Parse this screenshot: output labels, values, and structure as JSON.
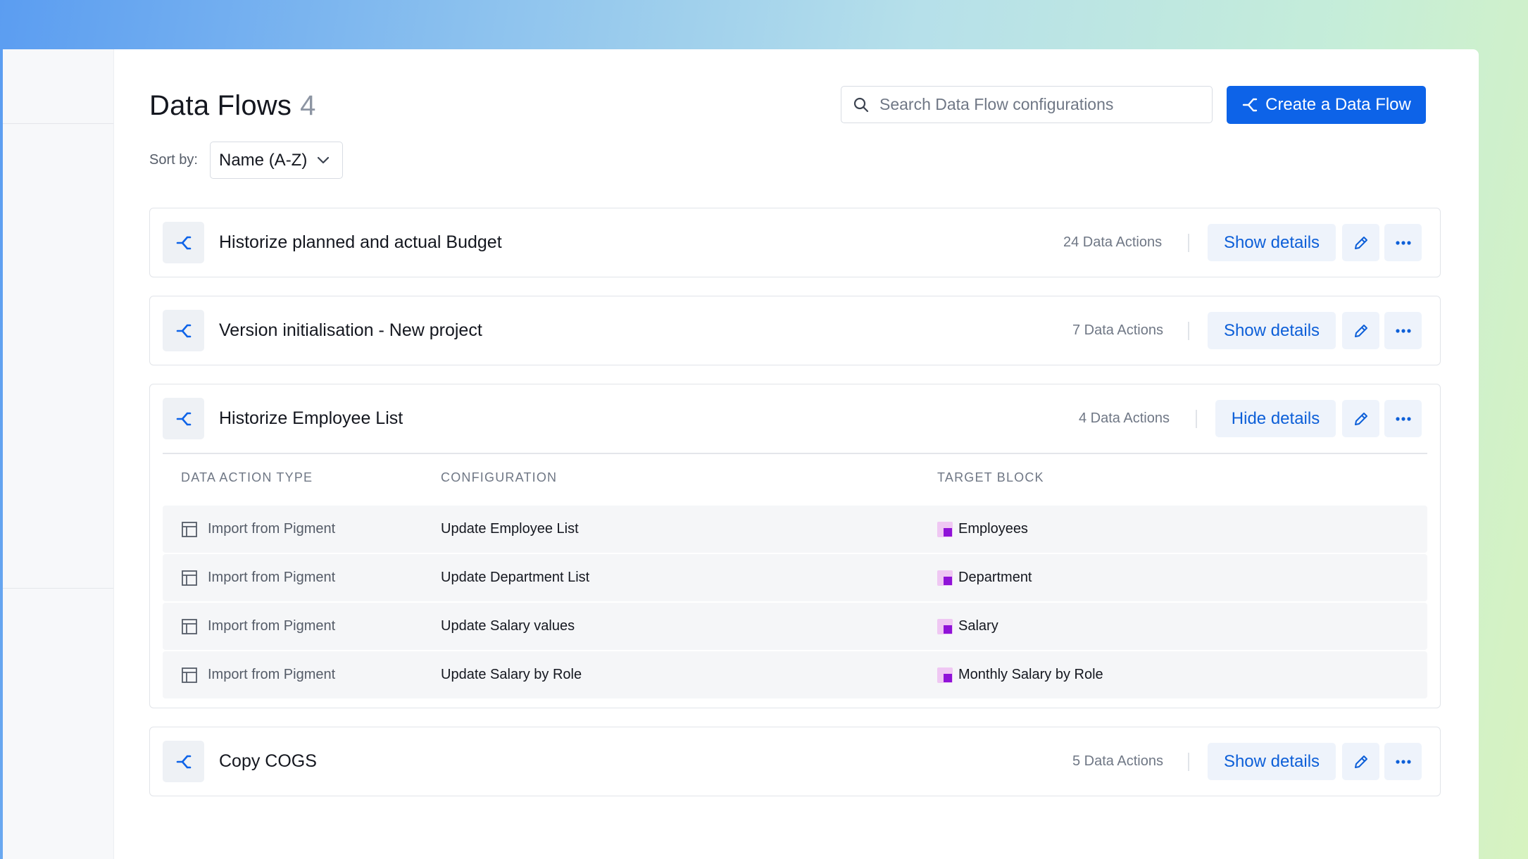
{
  "page": {
    "title": "Data Flows",
    "count": "4"
  },
  "search": {
    "placeholder": "Search Data Flow configurations"
  },
  "create_button": {
    "label": "Create a Data Flow"
  },
  "sort": {
    "label": "Sort by:",
    "value": "Name (A-Z)"
  },
  "flows": [
    {
      "name": "Historize planned and actual Budget",
      "count": "24 Data Actions",
      "details_label": "Show details",
      "expanded": false
    },
    {
      "name": "Version initialisation - New project",
      "count": "7 Data Actions",
      "details_label": "Show details",
      "expanded": false
    },
    {
      "name": "Historize Employee List",
      "count": "4 Data Actions",
      "details_label": "Hide details",
      "expanded": true
    },
    {
      "name": "Copy COGS",
      "count": "5 Data Actions",
      "details_label": "Show details",
      "expanded": false
    }
  ],
  "actions_table": {
    "headers": [
      "DATA ACTION TYPE",
      "CONFIGURATION",
      "TARGET BLOCK"
    ],
    "rows": [
      {
        "type": "Import from Pigment",
        "configuration": "Update Employee List",
        "target": "Employees"
      },
      {
        "type": "Import from Pigment",
        "configuration": "Update Department List",
        "target": "Department"
      },
      {
        "type": "Import from Pigment",
        "configuration": "Update Salary values",
        "target": "Salary"
      },
      {
        "type": "Import from Pigment",
        "configuration": "Update Salary by Role",
        "target": "Monthly Salary by Role"
      }
    ]
  },
  "colors": {
    "accent": "#0d63e8",
    "button_bg": "#eef3fb",
    "block_icon": "#8f12d8"
  },
  "icons": {
    "search": "search-icon",
    "flow": "data-flow-icon",
    "edit": "pencil-icon",
    "more": "ellipsis-icon",
    "chevron": "chevron-down-icon",
    "import": "import-table-icon",
    "block": "block-icon"
  }
}
